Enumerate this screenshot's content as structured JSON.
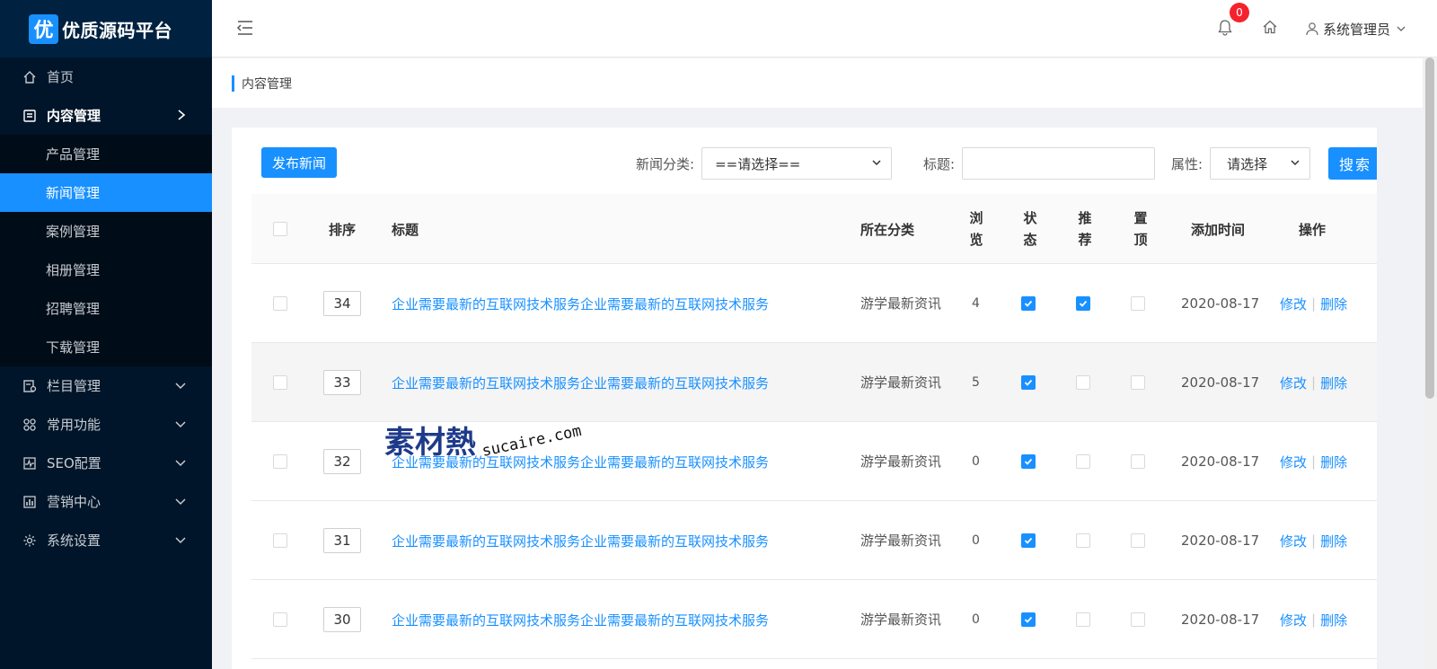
{
  "app": {
    "logo_char": "优",
    "logo_text": "优质源码平台"
  },
  "sidebar": {
    "items": [
      {
        "label": "首页",
        "icon": "home-icon"
      },
      {
        "label": "内容管理",
        "icon": "document-icon",
        "open": true
      },
      {
        "label": "栏目管理",
        "icon": "column-icon"
      },
      {
        "label": "常用功能",
        "icon": "apps-icon"
      },
      {
        "label": "SEO配置",
        "icon": "chart-line-icon"
      },
      {
        "label": "营销中心",
        "icon": "bar-chart-icon"
      },
      {
        "label": "系统设置",
        "icon": "gear-icon"
      }
    ],
    "submenu": [
      {
        "label": "产品管理"
      },
      {
        "label": "新闻管理",
        "active": true
      },
      {
        "label": "案例管理"
      },
      {
        "label": "相册管理"
      },
      {
        "label": "招聘管理"
      },
      {
        "label": "下载管理"
      }
    ]
  },
  "header": {
    "notification_count": "0",
    "user_name": "系统管理员"
  },
  "breadcrumb": {
    "current": "内容管理"
  },
  "toolbar": {
    "publish_label": "发布新闻",
    "category_label": "新闻分类:",
    "category_value": "==请选择==",
    "title_label": "标题:",
    "title_value": "",
    "attr_label": "属性:",
    "attr_value": "请选择",
    "search_label": "搜索"
  },
  "table": {
    "headers": {
      "sort": "排序",
      "title": "标题",
      "category": "所在分类",
      "views": [
        "浏",
        "览"
      ],
      "status": [
        "状",
        "态"
      ],
      "recommend": [
        "推",
        "荐"
      ],
      "top": [
        "置",
        "顶"
      ],
      "date": "添加时间",
      "ops": "操作"
    },
    "rows": [
      {
        "sort": "34",
        "title": "企业需要最新的互联网技术服务企业需要最新的互联网技术服务",
        "category": "游学最新资讯",
        "views": "4",
        "status": true,
        "recommend": true,
        "top": false,
        "date": "2020-08-17"
      },
      {
        "sort": "33",
        "title": "企业需要最新的互联网技术服务企业需要最新的互联网技术服务",
        "category": "游学最新资讯",
        "views": "5",
        "status": true,
        "recommend": false,
        "top": false,
        "date": "2020-08-17"
      },
      {
        "sort": "32",
        "title": "企业需要最新的互联网技术服务企业需要最新的互联网技术服务",
        "category": "游学最新资讯",
        "views": "0",
        "status": true,
        "recommend": false,
        "top": false,
        "date": "2020-08-17"
      },
      {
        "sort": "31",
        "title": "企业需要最新的互联网技术服务企业需要最新的互联网技术服务",
        "category": "游学最新资讯",
        "views": "0",
        "status": true,
        "recommend": false,
        "top": false,
        "date": "2020-08-17"
      },
      {
        "sort": "30",
        "title": "企业需要最新的互联网技术服务企业需要最新的互联网技术服务",
        "category": "游学最新资讯",
        "views": "0",
        "status": true,
        "recommend": false,
        "top": false,
        "date": "2020-08-17"
      }
    ],
    "edit_label": "修改",
    "delete_label": "删除"
  },
  "watermark": {
    "text1": "素材熱",
    "text2": "sucaire.com"
  },
  "colors": {
    "primary": "#1890ff",
    "sidebar_bg": "#001529",
    "badge": "#f5222d"
  }
}
